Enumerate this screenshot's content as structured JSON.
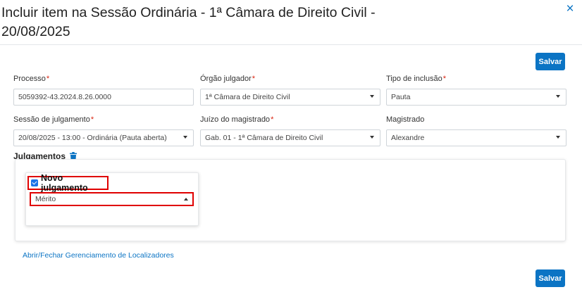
{
  "modal": {
    "title": "Incluir item na Sessão Ordinária - 1ª Câmara de Direito Civil - 20/08/2025",
    "close_glyph": "×",
    "save_label": "Salvar"
  },
  "fields": {
    "processo": {
      "label": "Processo",
      "value": "5059392-43.2024.8.26.0000"
    },
    "orgao": {
      "label": "Órgão julgador",
      "value": "1ª Câmara de Direito Civil"
    },
    "tipo": {
      "label": "Tipo de inclusão",
      "value": "Pauta"
    },
    "sessao": {
      "label": "Sessão de julgamento",
      "value": "20/08/2025 - 13:00 - Ordinária (Pauta aberta)"
    },
    "juizo": {
      "label": "Juízo do magistrado",
      "value": "Gab. 01 - 1ª Câmara de Direito Civil"
    },
    "magistrado": {
      "label": "Magistrado",
      "value": "Alexandre"
    },
    "required_mark": "*"
  },
  "julgamentos": {
    "title": "Julgamentos",
    "novo_label": "Novo julgamento",
    "novo_checked": true,
    "tipo_value": "Mérito"
  },
  "locator_link": "Abrir/Fechar Gerenciamento de Localizadores",
  "colors": {
    "primary": "#0b74c4",
    "highlight": "#e00000",
    "required": "#d9230f"
  }
}
